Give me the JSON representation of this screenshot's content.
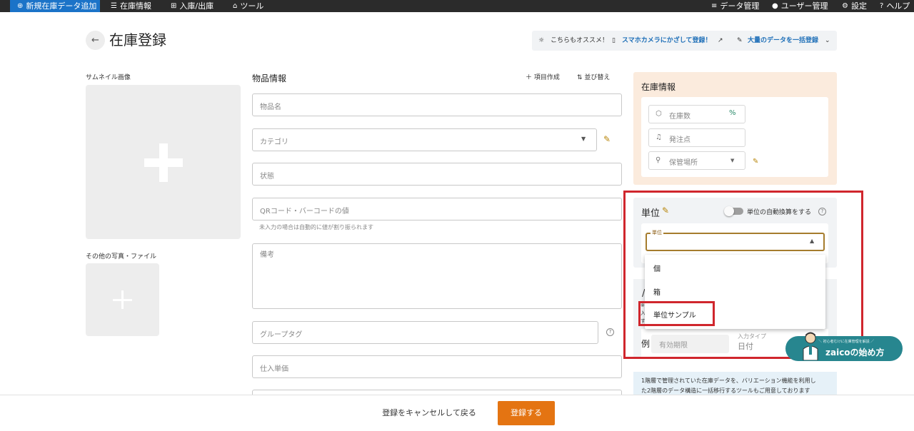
{
  "nav": {
    "add_label": "新規在庫データ追加",
    "inventory_label": "在庫情報",
    "inout_label": "入庫/出庫",
    "tools_label": "ツール",
    "data_mgmt_label": "データ管理",
    "user_mgmt_label": "ユーザー管理",
    "settings_label": "設定",
    "help_label": "ヘルプ"
  },
  "header": {
    "title": "在庫登録",
    "promo_label": "こちらもオススメ！",
    "promo_camera": "スマホカメラにかざして登録！",
    "promo_bulk": "大量のデータを一括登録"
  },
  "left": {
    "thumbnail_label": "サムネイル画像",
    "other_files_label": "その他の写真・ファイル"
  },
  "item_info": {
    "title": "物品情報",
    "add_field_label": "項目作成",
    "sort_label": "並び替え",
    "name_placeholder": "物品名",
    "category_placeholder": "カテゴリ",
    "state_placeholder": "状態",
    "code_placeholder": "QRコード・バーコードの値",
    "code_hint": "未入力の場合は自動的に値が割り振られます",
    "memo_placeholder": "備考",
    "group_tag_placeholder": "グループタグ",
    "purchase_price_placeholder": "仕入単価"
  },
  "stock_info": {
    "title": "在庫情報",
    "quantity_placeholder": "在庫数",
    "reorder_placeholder": "発注点",
    "location_placeholder": "保管場所"
  },
  "unit": {
    "title": "単位",
    "auto_convert_label": "単位の自動換算をする",
    "select_label": "単位",
    "options": [
      "個",
      "箱",
      "単位サンプル"
    ]
  },
  "variation": {
    "example_label": "例",
    "expiry_placeholder": "有効期限",
    "input_type_label": "入力タイプ",
    "input_type_value": "日付"
  },
  "zaico_badge": {
    "sub": "＼ 初心者むけに在庫管理を解説 ／",
    "main": "zaicoの始め方"
  },
  "info_box": {
    "line1": "1階層で管理されていた在庫データを、バリエーション機能を利用し",
    "line2": "た2階層のデータ構造に一括移行するツールもご用意しております"
  },
  "footer": {
    "cancel_label": "登録をキャンセルして戻る",
    "submit_label": "登録する"
  },
  "colors": {
    "nav_bg": "#2b2b2b",
    "nav_accent": "#1b73c8",
    "primary_button": "#e47412",
    "highlight": "#d0262d",
    "stock_panel": "#fbebdd"
  }
}
